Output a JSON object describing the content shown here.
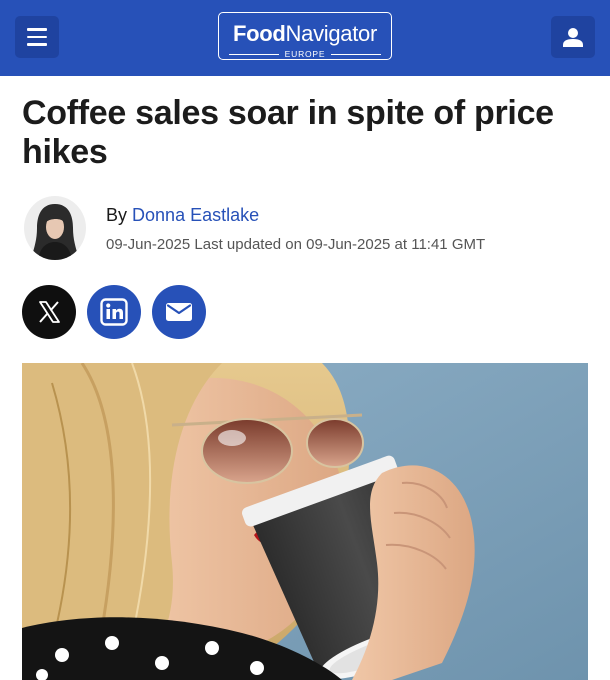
{
  "header": {
    "logo_bold": "Food",
    "logo_regular": "Navigator",
    "logo_sub": "EUROPE",
    "menu_icon": "hamburger-menu-icon",
    "account_icon": "user-icon",
    "brand_color": "#2751b8"
  },
  "article": {
    "headline": "Coffee sales soar in spite of price hikes",
    "byline_prefix": "By",
    "author": "Donna Eastlake",
    "dates": "09-Jun-2025 Last updated on 09-Jun-2025 at 11:41 GMT"
  },
  "share": {
    "icons": [
      "x-icon",
      "linkedin-icon",
      "email-icon"
    ]
  },
  "hero_image": {
    "subject": "woman-with-sunglasses-drinking-coffee-icon"
  }
}
